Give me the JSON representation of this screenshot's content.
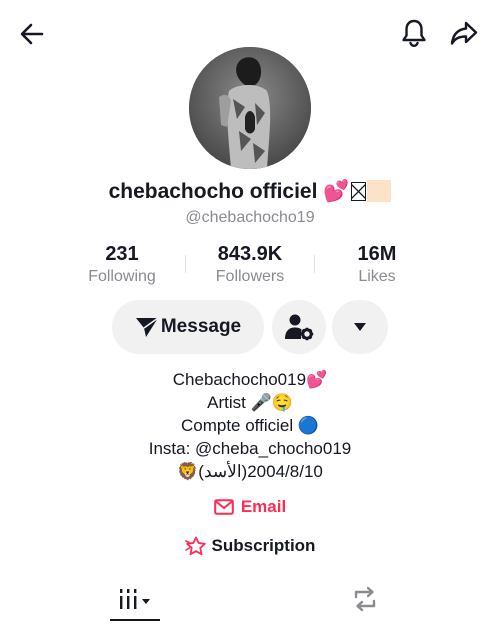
{
  "header": {
    "back_icon": "arrow-left-icon",
    "bell_icon": "bell-icon",
    "share_icon": "share-arrow-icon"
  },
  "profile": {
    "display_name": "chebachocho officiel 💕",
    "handle": "@chebachocho19"
  },
  "stats": [
    {
      "value": "231",
      "label": "Following"
    },
    {
      "value": "843.9K",
      "label": "Followers"
    },
    {
      "value": "16M",
      "label": "Likes"
    }
  ],
  "actions": {
    "message_label": "Message",
    "message_icon": "send-icon",
    "add_friend_icon": "person-settings-icon",
    "more_icon": "caret-down-icon"
  },
  "bio": {
    "line1": "Chebachocho019💕",
    "line2": "Artist 🎤🤤",
    "line3": "Compte officiel 🔵",
    "line4": "Insta: @cheba_chocho019",
    "line5": "🦁(الأسد)2004/8/10"
  },
  "links": {
    "email_label": "Email",
    "subscription_label": "Subscription"
  },
  "tabs": {
    "videos_icon": "grid-bars-icon",
    "repost_icon": "repost-icon"
  },
  "colors": {
    "accent": "#fe2c55",
    "text": "#161823",
    "muted": "#8a8b91",
    "button_bg": "#f1f1f2"
  }
}
